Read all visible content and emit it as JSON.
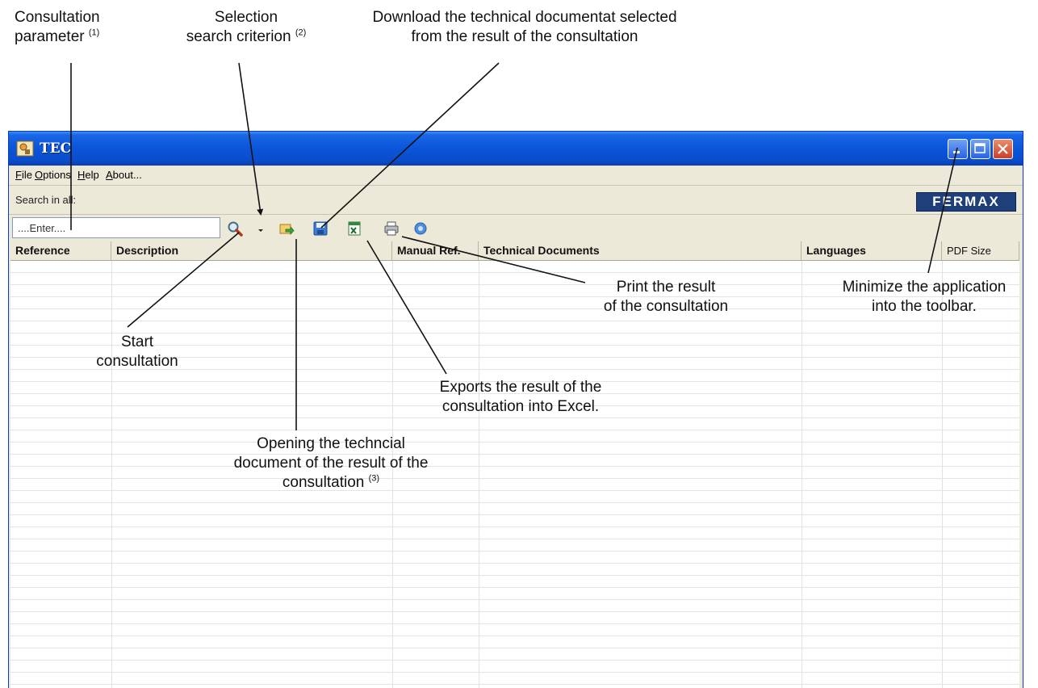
{
  "annotations": {
    "consultation_parameter": {
      "line1": "Consultation",
      "line2": "parameter",
      "note": "(1)"
    },
    "selection_criterion": {
      "line1": "Selection",
      "line2": "search criterion",
      "note": "(2)"
    },
    "download": {
      "line1": "Download the technical documentat selected",
      "line2": "from the result of the consultation"
    },
    "print": {
      "line1": "Print the result",
      "line2": "of the consultation"
    },
    "minimize": {
      "line1": "Minimize the application",
      "line2": "into the toolbar."
    },
    "start": {
      "line1": "Start",
      "line2": "consultation"
    },
    "export_excel": {
      "line1": "Exports the result of the",
      "line2": "consultation into Excel."
    },
    "open_document": {
      "line1": "Opening the techncial",
      "line2": "document of the result of the",
      "line3": "consultation",
      "note": "(3)"
    }
  },
  "window": {
    "title": "TEC",
    "menu": [
      {
        "label": "File",
        "accel": "F",
        "rest": "ile"
      },
      {
        "label": "Options",
        "accel": "O",
        "rest": "ptions"
      },
      {
        "label": "Help",
        "accel": "H",
        "rest": "elp"
      },
      {
        "label": "About...",
        "accel": "A",
        "rest": "bout..."
      }
    ],
    "search_label": "Search in all:",
    "logo_text": "FERMAX",
    "search_input": {
      "value": "....Enter...."
    },
    "columns": [
      "Reference",
      "Description",
      "Manual Ref.",
      "Technical Documents",
      "Languages",
      "PDF Size"
    ]
  },
  "colors": {
    "titlebar": "#0a4dcc",
    "window_bg": "#ece9d8",
    "logo_bg": "#1e3f7a"
  },
  "icons": [
    "search-icon",
    "dropdown-arrow-icon",
    "open-document-icon",
    "save-icon",
    "excel-icon",
    "print-icon",
    "help-icon"
  ]
}
